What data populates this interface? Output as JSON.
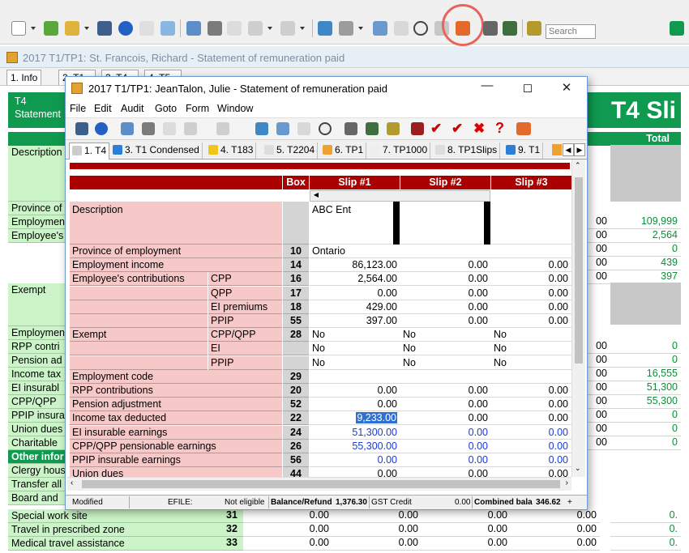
{
  "toolbar": {
    "search_placeholder": "Search"
  },
  "bg_window": {
    "title": "2017 T1/TP1: St. Francois, Richard - Statement of remuneration paid",
    "tabs": [
      "1. Info",
      "2. T1",
      "3. T4",
      "4. T5"
    ],
    "header": {
      "left1": "T4",
      "left2": "Statement",
      "right": "T4 Sli",
      "total": "Total"
    },
    "left_rows": [
      "Description",
      "Province of",
      "Employmen",
      "Employee's",
      "Exempt",
      "Employmen",
      "RPP contri",
      "Pension ad",
      "Income tax",
      "EI insurabl",
      "CPP/QPP",
      "PPIP insura",
      "Union dues",
      "Charitable",
      "Other infor",
      "Clergy hous",
      "Transfer all",
      "Board and",
      "Special work site",
      "Travel in prescribed zone",
      "Medical travel assistance"
    ],
    "bottom_rows": [
      {
        "label": "Special work site",
        "box": "31",
        "v1": "0.00",
        "v2": "0.00",
        "v3": "0.00",
        "v4": "0.00",
        "total": "0."
      },
      {
        "label": "Travel in prescribed zone",
        "box": "32",
        "v1": "0.00",
        "v2": "0.00",
        "v3": "0.00",
        "v4": "0.00",
        "total": "0."
      },
      {
        "label": "Medical travel assistance",
        "box": "33",
        "v1": "0.00",
        "v2": "0.00",
        "v3": "0.00",
        "v4": "0.00",
        "total": "0."
      }
    ],
    "right_values": [
      "00",
      "00",
      "00",
      "00",
      "00",
      "00",
      "00",
      "00",
      "00",
      "00",
      "00",
      "00",
      "00",
      "00",
      "00",
      "00"
    ],
    "totals": [
      "109,999",
      "2,564",
      "0",
      "439",
      "397",
      "0",
      "0",
      "16,555",
      "51,300",
      "55,300",
      "0",
      "0",
      "0",
      "0",
      "0",
      "0"
    ]
  },
  "main_window": {
    "title": "2017 T1/TP1: JeanTalon, Julie - Statement of remuneration paid",
    "menu": [
      "File",
      "Edit",
      "Audit",
      "Goto",
      "Form",
      "Window"
    ],
    "tabs": [
      "1. T4",
      "3. T1 Condensed",
      "4. T183",
      "5. T2204",
      "6. TP1",
      "7. TP1000",
      "8. TP1Slips",
      "9. T1"
    ],
    "columns": {
      "box": "Box",
      "slip1": "Slip #1",
      "slip2": "Slip #2",
      "slip3": "Slip #3"
    },
    "description": {
      "label": "Description",
      "slip1": "ABC Ent"
    },
    "rows": [
      {
        "label": "Province of employment",
        "sub": "",
        "box": "10",
        "s1": "Ontario",
        "s2": "",
        "s3": "",
        "type": "text"
      },
      {
        "label": "Employment income",
        "sub": "",
        "box": "14",
        "s1": "86,123.00",
        "s2": "0.00",
        "s3": "0.00"
      },
      {
        "label": "Employee's contributions",
        "sub": "CPP",
        "box": "16",
        "s1": "2,564.00",
        "s2": "0.00",
        "s3": "0.00"
      },
      {
        "label": "",
        "sub": "QPP",
        "box": "17",
        "s1": "0.00",
        "s2": "0.00",
        "s3": "0.00"
      },
      {
        "label": "",
        "sub": "EI premiums",
        "box": "18",
        "s1": "429.00",
        "s2": "0.00",
        "s3": "0.00"
      },
      {
        "label": "",
        "sub": "PPIP",
        "box": "55",
        "s1": "397.00",
        "s2": "0.00",
        "s3": "0.00"
      },
      {
        "label": "Exempt",
        "sub": "CPP/QPP",
        "box": "28",
        "s1": "No",
        "s2": "No",
        "s3": "No",
        "type": "text"
      },
      {
        "label": "",
        "sub": "EI",
        "box": "",
        "s1": "No",
        "s2": "No",
        "s3": "No",
        "type": "text"
      },
      {
        "label": "",
        "sub": "PPIP",
        "box": "",
        "s1": "No",
        "s2": "No",
        "s3": "No",
        "type": "text"
      },
      {
        "label": "Employment code",
        "sub": "",
        "box": "29",
        "s1": "",
        "s2": "",
        "s3": "",
        "type": "text"
      },
      {
        "label": "RPP contributions",
        "sub": "",
        "box": "20",
        "s1": "0.00",
        "s2": "0.00",
        "s3": "0.00"
      },
      {
        "label": "Pension adjustment",
        "sub": "",
        "box": "52",
        "s1": "0.00",
        "s2": "0.00",
        "s3": "0.00"
      },
      {
        "label": "Income tax deducted",
        "sub": "",
        "box": "22",
        "s1": "9,233.00",
        "s2": "0.00",
        "s3": "0.00",
        "selected": true
      },
      {
        "label": "EI insurable earnings",
        "sub": "",
        "box": "24",
        "s1": "51,300.00",
        "s2": "0.00",
        "s3": "0.00",
        "blue": true
      },
      {
        "label": "CPP/QPP pensionable earnings",
        "sub": "",
        "box": "26",
        "s1": "55,300.00",
        "s2": "0.00",
        "s3": "0.00",
        "blue": true
      },
      {
        "label": "PPIP insurable earnings",
        "sub": "",
        "box": "56",
        "s1": "0.00",
        "s2": "0.00",
        "s3": "0.00",
        "blue": true
      },
      {
        "label": "Union dues",
        "sub": "",
        "box": "44",
        "s1": "0.00",
        "s2": "0.00",
        "s3": "0.00"
      }
    ],
    "status": {
      "modified": "Modified",
      "efile_label": "EFILE:",
      "efile_value": "Not eligible",
      "balance_label": "Balance/Refund",
      "balance_value": "1,376.30",
      "gst_label": "GST Credit",
      "gst_value": "0.00",
      "combined_label": "Combined bala",
      "combined_value": "346.62",
      "plus": "+"
    }
  },
  "colors": {
    "green": "#0f9a50",
    "red": "#aa0000",
    "pink": "#f7c8c8",
    "light_green": "#cbf5c8",
    "blue_text": "#1a3bd6"
  }
}
